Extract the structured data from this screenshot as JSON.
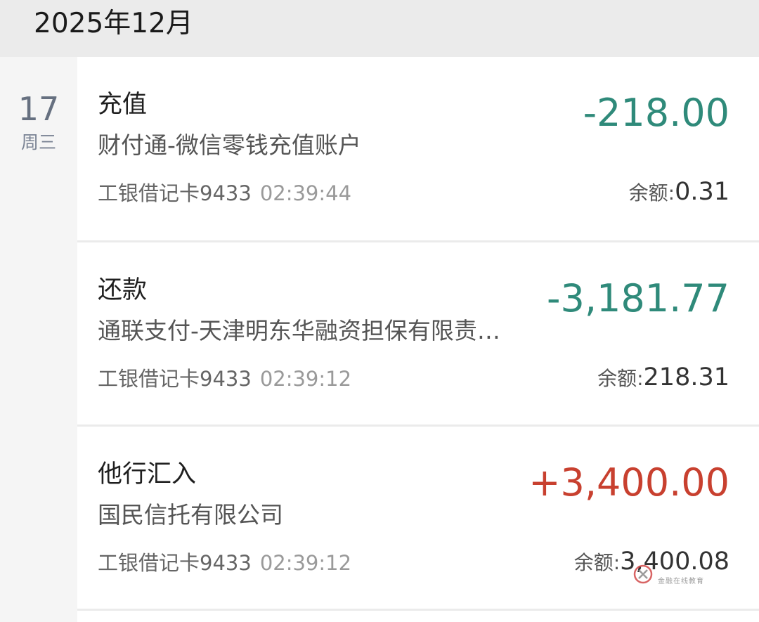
{
  "header": {
    "month": "2025年12月"
  },
  "date_group": {
    "day": "17",
    "weekday": "周三"
  },
  "transactions": [
    {
      "type": "充值",
      "merchant": "财付通-微信零钱充值账户",
      "card": "工银借记卡9433",
      "time": "02:39:44",
      "amount": "-218.00",
      "direction": "out",
      "balance_label": "余额:",
      "balance_value": "0.31"
    },
    {
      "type": "还款",
      "merchant": "通联支付-天津明东华融资担保有限责…",
      "card": "工银借记卡9433",
      "time": "02:39:12",
      "amount": "-3,181.77",
      "direction": "out",
      "balance_label": "余额:",
      "balance_value": "218.31"
    },
    {
      "type": "他行汇入",
      "merchant": "国民信托有限公司",
      "card": "工银借记卡9433",
      "time": "02:39:12",
      "amount": "+3,400.00",
      "direction": "in",
      "balance_label": "余额:",
      "balance_value": "3,400.08"
    }
  ],
  "watermark": {
    "text": "金融在线教育"
  },
  "colors": {
    "expense": "#2f8a7a",
    "income": "#c8402f",
    "header_bg": "#ebebeb",
    "date_col_bg": "#f5f5f5"
  }
}
